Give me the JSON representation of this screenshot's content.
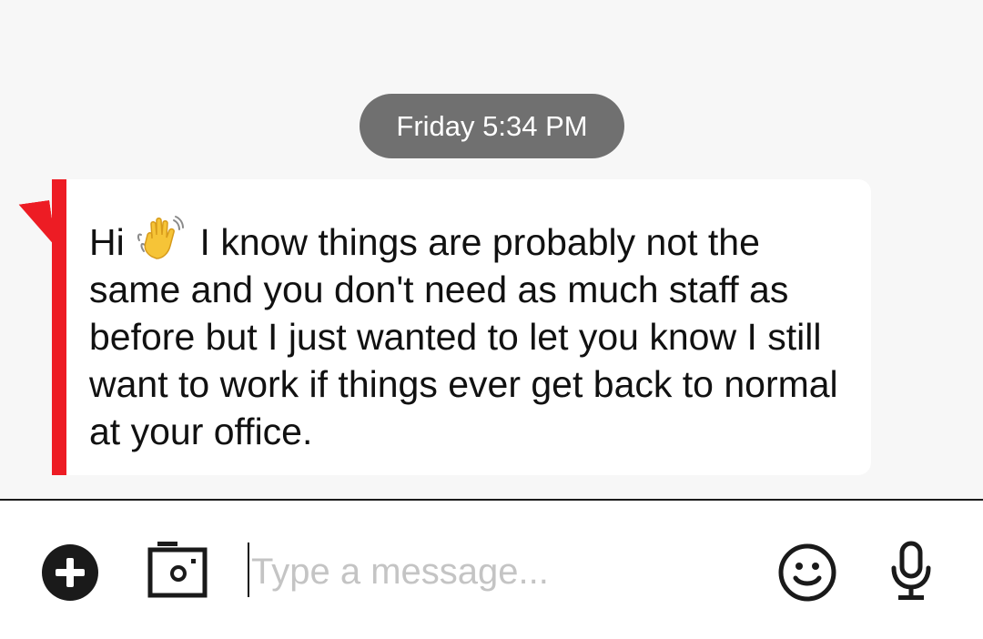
{
  "conversation": {
    "timestamp": "Friday 5:34 PM",
    "message": {
      "greeting": "Hi",
      "emoji": "waving-hand-emoji",
      "body": "I know things are probably not the same and you don't need as much staff as before but I just wanted to let you know I still want to work if things ever get back to normal at your office.",
      "accent_color": "#ed1c24"
    }
  },
  "composer": {
    "placeholder": "Type a message...",
    "value": "",
    "icons": {
      "add": "plus-icon",
      "camera": "camera-icon",
      "emoji": "emoji-icon",
      "voice": "mic-icon"
    }
  },
  "colors": {
    "background": "#f7f7f7",
    "timestamp_pill": "#707070",
    "bubble": "#ffffff",
    "accent": "#ed1c24"
  }
}
